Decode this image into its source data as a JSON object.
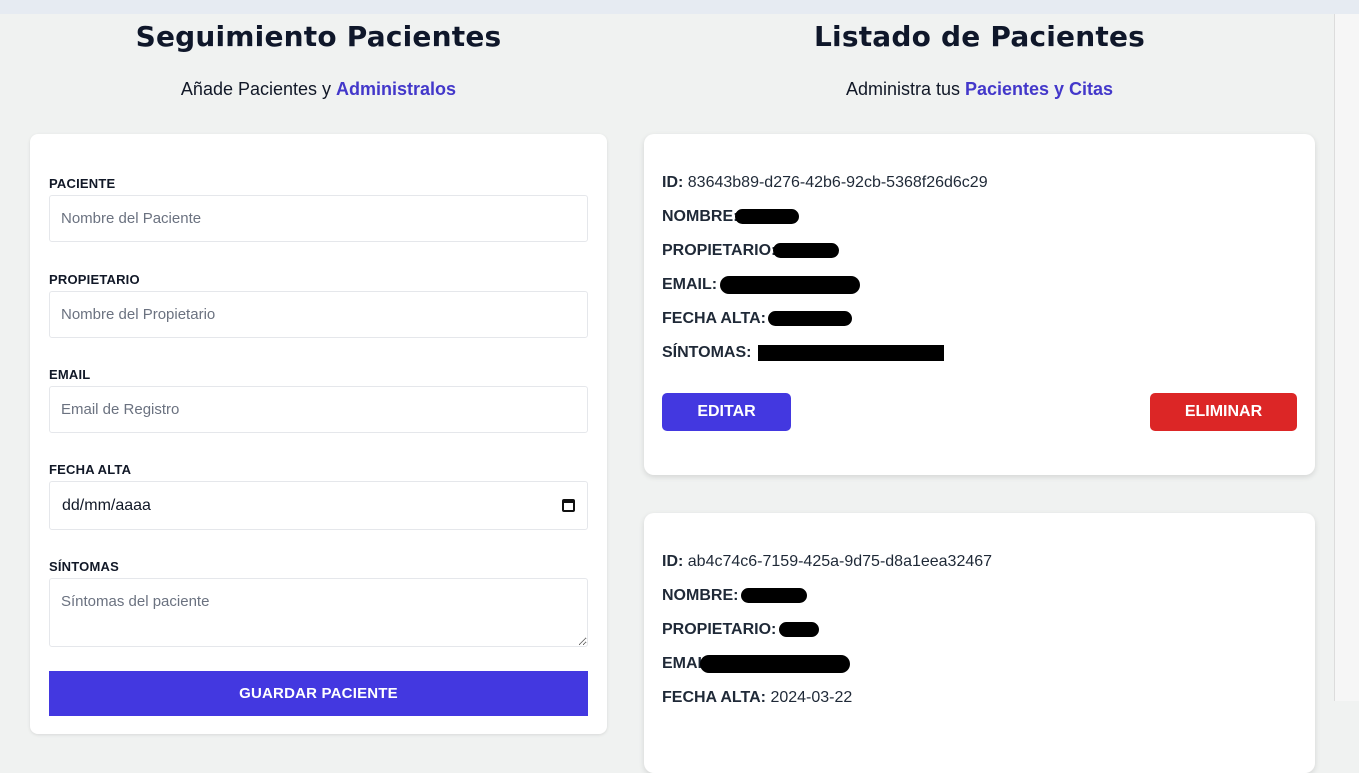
{
  "form_section": {
    "title": "Seguimiento Pacientes",
    "subtitle_prefix": "Añade Pacientes y ",
    "subtitle_accent": "Administralos",
    "fields": {
      "paciente": {
        "label": "Paciente",
        "placeholder": "Nombre del Paciente",
        "value": ""
      },
      "propietario": {
        "label": "Propietario",
        "placeholder": "Nombre del Propietario",
        "value": ""
      },
      "email": {
        "label": "Email",
        "placeholder": "Email de Registro",
        "value": ""
      },
      "fecha_alta": {
        "label": "Fecha Alta",
        "display_value": "dd/mm/aaaa"
      },
      "sintomas": {
        "label": "Síntomas",
        "placeholder": "Síntomas del paciente",
        "value": ""
      }
    },
    "save_label": "Guardar Paciente"
  },
  "list_section": {
    "title": "Listado de Pacientes",
    "subtitle_prefix": "Administra tus ",
    "subtitle_accent": "Pacientes y Citas",
    "field_labels": {
      "id": "ID:",
      "nombre": "Nombre:",
      "propietario": "Propietario:",
      "email": "Email:",
      "fecha_alta": "Fecha Alta:",
      "sintomas": "Síntomas:"
    },
    "edit_label": "Editar",
    "delete_label": "Eliminar",
    "patients": [
      {
        "id": "83643b89-d276-42b6-92cb-5368f26d6c29",
        "nombre": "",
        "propietario": "",
        "email": "",
        "fecha_alta": "",
        "sintomas": ""
      },
      {
        "id": "ab4c74c6-7159-425a-9d75-d8a1eea32467",
        "nombre": "",
        "propietario": "",
        "email": "",
        "fecha_alta": "2024-03-22",
        "sintomas": ""
      }
    ]
  },
  "colors": {
    "accent": "#4338ca",
    "primary_button": "#4338e0",
    "danger_button": "#dc2626",
    "background": "#f0f2f1"
  },
  "icons": {
    "date_picker": "calendar-icon"
  }
}
